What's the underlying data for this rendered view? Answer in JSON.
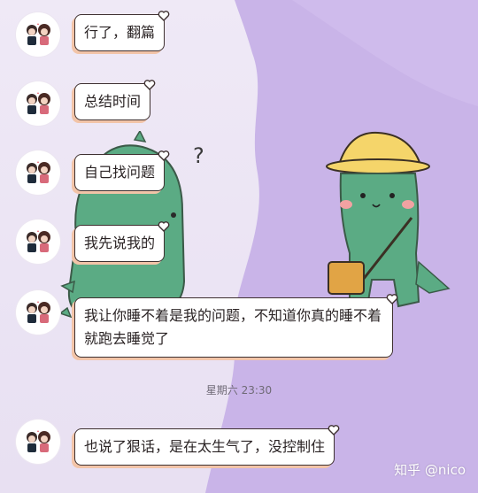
{
  "messages": [
    {
      "text": "行了，翻篇"
    },
    {
      "text": "总结时间"
    },
    {
      "text": "自己找问题"
    },
    {
      "text": "我先说我的"
    },
    {
      "text": "我让你睡不着是我的问题，不知道你真的睡不着就跑去睡觉了"
    },
    {
      "text": "也说了狠话，是在太生气了，没控制住"
    }
  ],
  "timestamp": "星期六 23:30",
  "watermark": "知乎 @nico",
  "decor": {
    "question_mark": "?",
    "colors": {
      "purple": "#c9b4e8",
      "dino_green": "#5bab84",
      "hat_yellow": "#f5d56a",
      "bubble_shadow": "#f2c4a8"
    }
  }
}
